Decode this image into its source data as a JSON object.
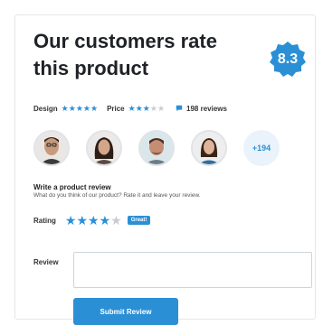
{
  "widget": {
    "title": "Our customers rate this product",
    "score": "8.3",
    "design_label": "Design",
    "design_stars": 5,
    "price_label": "Price",
    "price_stars": 3,
    "reviews_count": "198 reviews",
    "more_reviewers": "+194",
    "accent_color": "#2b8fd6"
  },
  "avatars": [
    {
      "name": "avatar-1"
    },
    {
      "name": "avatar-2"
    },
    {
      "name": "avatar-3"
    },
    {
      "name": "avatar-4"
    }
  ],
  "review_form": {
    "title": "Write a product review",
    "subtitle": "What do you think of our product? Rate it and leave your review.",
    "rating_label": "Rating",
    "rating_value": 4,
    "rating_badge": "Great!",
    "review_label": "Review",
    "review_value": "",
    "submit_label": "Submit Review"
  }
}
